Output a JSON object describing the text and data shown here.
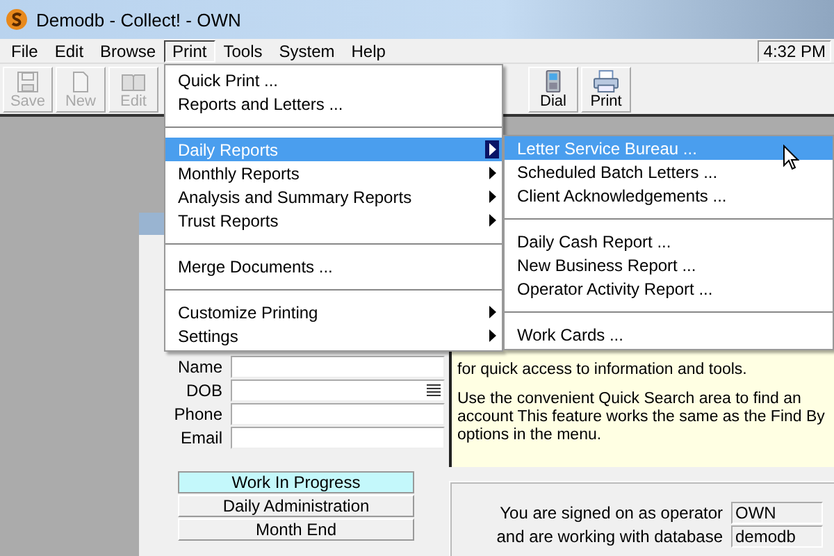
{
  "window": {
    "title": "Demodb - Collect! - OWN",
    "clock": "4:32 PM"
  },
  "menu_bar": [
    {
      "label": "File",
      "selected": false
    },
    {
      "label": "Edit",
      "selected": false
    },
    {
      "label": "Browse",
      "selected": false
    },
    {
      "label": "Print",
      "selected": true
    },
    {
      "label": "Tools",
      "selected": false
    },
    {
      "label": "System",
      "selected": false
    },
    {
      "label": "Help",
      "selected": false
    }
  ],
  "toolbar_left": [
    {
      "kind": "save",
      "label": "Save",
      "disabled": true
    },
    {
      "kind": "new",
      "label": "New",
      "disabled": true
    },
    {
      "kind": "edit",
      "label": "Edit",
      "disabled": true
    }
  ],
  "toolbar_right": [
    {
      "kind": "dial",
      "label": "Dial",
      "disabled": false
    },
    {
      "kind": "print",
      "label": "Print",
      "disabled": false
    }
  ],
  "print_menu": [
    {
      "kind": "item",
      "label": "Quick Print ...",
      "submenu": false,
      "selected": false
    },
    {
      "kind": "item",
      "label": "Reports and Letters ...",
      "submenu": false,
      "selected": false
    },
    {
      "kind": "separator"
    },
    {
      "kind": "item",
      "label": "Daily Reports",
      "submenu": true,
      "selected": true
    },
    {
      "kind": "item",
      "label": "Monthly Reports",
      "submenu": true,
      "selected": false
    },
    {
      "kind": "item",
      "label": "Analysis and Summary Reports",
      "submenu": true,
      "selected": false
    },
    {
      "kind": "item",
      "label": "Trust Reports",
      "submenu": true,
      "selected": false
    },
    {
      "kind": "separator"
    },
    {
      "kind": "item",
      "label": "Merge Documents ...",
      "submenu": false,
      "selected": false
    },
    {
      "kind": "separator"
    },
    {
      "kind": "item",
      "label": "Customize Printing",
      "submenu": true,
      "selected": false
    },
    {
      "kind": "item",
      "label": "Settings",
      "submenu": true,
      "selected": false
    }
  ],
  "daily_reports_menu": [
    {
      "kind": "item",
      "label": "Letter Service Bureau ...",
      "submenu": false,
      "selected": true
    },
    {
      "kind": "item",
      "label": "Scheduled Batch Letters ...",
      "submenu": false,
      "selected": false
    },
    {
      "kind": "item",
      "label": "Client Acknowledgements ...",
      "submenu": false,
      "selected": false
    },
    {
      "kind": "separator"
    },
    {
      "kind": "item",
      "label": "Daily Cash Report ...",
      "submenu": false,
      "selected": false
    },
    {
      "kind": "item",
      "label": "New Business Report ...",
      "submenu": false,
      "selected": false
    },
    {
      "kind": "item",
      "label": "Operator Activity Report ...",
      "submenu": false,
      "selected": false
    },
    {
      "kind": "separator"
    },
    {
      "kind": "item",
      "label": "Work Cards ...",
      "submenu": false,
      "selected": false
    }
  ],
  "search_fields": [
    {
      "label": "Name",
      "picker": false
    },
    {
      "label": "DOB",
      "picker": true
    },
    {
      "label": "Phone",
      "picker": false
    },
    {
      "label": "Email",
      "picker": false
    }
  ],
  "info_panel": {
    "paragraphs": [
      "for quick access to information and tools.",
      "Use the convenient Quick Search area to find an account This feature works the same as the Find By options in the menu."
    ]
  },
  "nav_buttons": [
    {
      "label": "Work In Progress",
      "selected": true
    },
    {
      "label": "Daily Administration",
      "selected": false
    },
    {
      "label": "Month End",
      "selected": false
    }
  ],
  "session": [
    {
      "label": "You are signed on as operator",
      "value": "OWN"
    },
    {
      "label": "and are working with database",
      "value": "demodb"
    }
  ]
}
